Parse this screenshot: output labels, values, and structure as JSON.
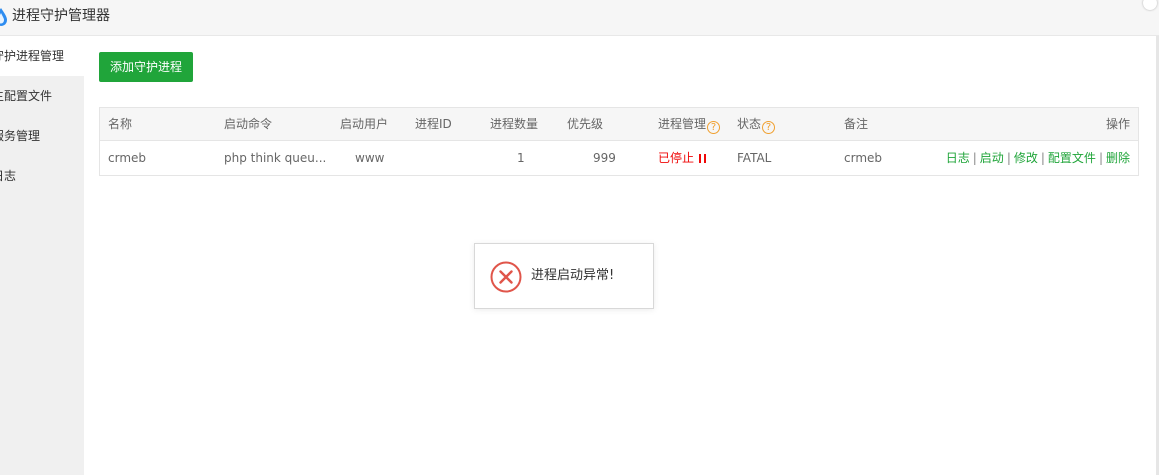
{
  "window": {
    "title": "进程守护管理器"
  },
  "sidebar": {
    "items": [
      {
        "label": "守护进程管理",
        "active": true
      },
      {
        "label": "主配置文件",
        "active": false
      },
      {
        "label": "服务管理",
        "active": false
      },
      {
        "label": "日志",
        "active": false
      }
    ]
  },
  "toolbar": {
    "add_label": "添加守护进程"
  },
  "table": {
    "headers": [
      "名称",
      "启动命令",
      "启动用户",
      "进程ID",
      "进程数量",
      "优先级",
      "进程管理",
      "状态",
      "备注",
      "操作"
    ],
    "rows": [
      {
        "name": "crmeb",
        "command": "php think queu...",
        "user": "www",
        "pid": "",
        "count": "1",
        "priority": "999",
        "manage": "已停止",
        "status": "FATAL",
        "remark": "crmeb",
        "actions": [
          "日志",
          "启动",
          "修改",
          "配置文件",
          "删除"
        ]
      }
    ]
  },
  "toast": {
    "message": "进程启动异常!"
  },
  "colors": {
    "accent": "#20a53a",
    "error": "#ef0808",
    "help": "#f0a030",
    "toast_error": "#e0554a"
  },
  "icons": {
    "app": "app-logo-icon",
    "help": "question-circle-icon",
    "pause": "pause-icon",
    "error": "error-circle-icon"
  }
}
